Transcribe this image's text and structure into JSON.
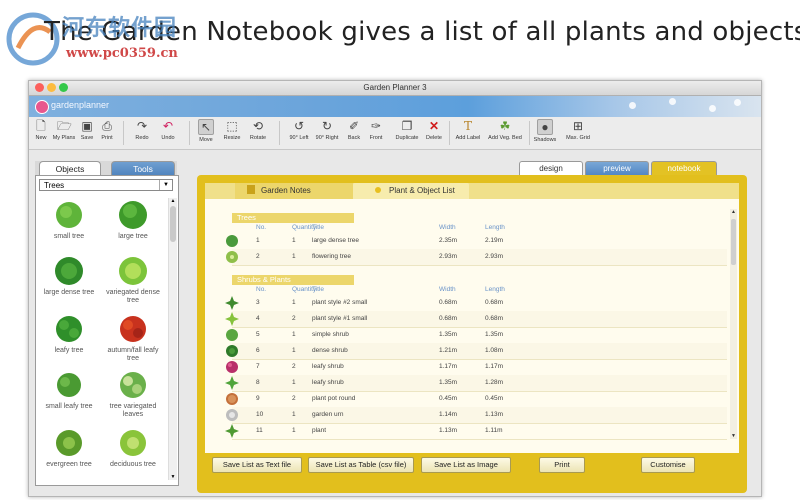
{
  "caption": "The Garden Notebook gives a list of all plants and objects",
  "watermark": {
    "cn": "河东软件园",
    "url": "www.pc0359.cn"
  },
  "window": {
    "title": "Garden Planner 3"
  },
  "banner": {
    "app_name": "gardenplanner"
  },
  "toolbar": {
    "new": "New",
    "my_plans": "My Plans",
    "save": "Save",
    "print": "Print",
    "redo": "Redo",
    "undo": "Undo",
    "move": "Move",
    "resize": "Resize",
    "rotate": "Rotate",
    "rot_left": "90° Left",
    "rot_right": "90° Right",
    "back": "Back",
    "front": "Front",
    "duplicate": "Duplicate",
    "delete": "Delete",
    "add_label": "Add Label",
    "add_veg_bed": "Add Veg. Bed",
    "shadows": "Shadows",
    "max_grid": "Max. Grid"
  },
  "left_panel": {
    "tab_objects": "Objects",
    "tab_tools": "Tools",
    "category": "Trees",
    "items": [
      {
        "label": "small tree",
        "icon": "small-tree-icon"
      },
      {
        "label": "large tree",
        "icon": "large-tree-icon"
      },
      {
        "label": "large dense tree",
        "icon": "large-dense-tree-icon"
      },
      {
        "label": "variegated dense tree",
        "icon": "variegated-dense-tree-icon"
      },
      {
        "label": "leafy tree",
        "icon": "leafy-tree-icon"
      },
      {
        "label": "autumn/fall leafy tree",
        "icon": "autumn-leafy-tree-icon"
      },
      {
        "label": "small leafy tree",
        "icon": "small-leafy-tree-icon"
      },
      {
        "label": "tree variegated leaves",
        "icon": "tree-variegated-leaves-icon"
      },
      {
        "label": "evergreen tree",
        "icon": "evergreen-tree-icon"
      },
      {
        "label": "deciduous tree",
        "icon": "deciduous-tree-icon"
      }
    ]
  },
  "view_tabs": {
    "design": "design",
    "preview": "preview",
    "notebook": "notebook"
  },
  "notebook": {
    "tab_garden_notes": "Garden Notes",
    "tab_plant_list": "Plant & Object List",
    "columns": {
      "no": "No.",
      "quantity": "Quantity",
      "title": "Title",
      "width": "Width",
      "length": "Length"
    },
    "sections": [
      {
        "name": "Trees",
        "rows": [
          {
            "no": "1",
            "qty": "1",
            "title": "large dense tree",
            "width": "2.35m",
            "length": "2.19m",
            "color": "#4a9a3c"
          },
          {
            "no": "2",
            "qty": "1",
            "title": "flowering tree",
            "width": "2.93m",
            "length": "2.93m",
            "color": "#8fbf4a"
          }
        ]
      },
      {
        "name": "Shrubs & Plants",
        "rows": [
          {
            "no": "3",
            "qty": "1",
            "title": "plant style #2  small",
            "width": "0.68m",
            "length": "0.68m",
            "color": "#3f8a2e"
          },
          {
            "no": "4",
            "qty": "2",
            "title": "plant style #1  small",
            "width": "0.68m",
            "length": "0.68m",
            "color": "#86c23c"
          },
          {
            "no": "5",
            "qty": "1",
            "title": "simple shrub",
            "width": "1.35m",
            "length": "1.35m",
            "color": "#5aa640"
          },
          {
            "no": "6",
            "qty": "1",
            "title": "dense shrub",
            "width": "1.21m",
            "length": "1.08m",
            "color": "#2f7a2a"
          },
          {
            "no": "7",
            "qty": "2",
            "title": "leafy shrub",
            "width": "1.17m",
            "length": "1.17m",
            "color": "#b8306a"
          },
          {
            "no": "8",
            "qty": "1",
            "title": "leafy shrub",
            "width": "1.35m",
            "length": "1.28m",
            "color": "#4fa43a"
          },
          {
            "no": "9",
            "qty": "2",
            "title": "plant pot  round",
            "width": "0.45m",
            "length": "0.45m",
            "color": "#c4703a"
          },
          {
            "no": "10",
            "qty": "1",
            "title": "garden urn",
            "width": "1.14m",
            "length": "1.13m",
            "color": "#bdbdbd"
          },
          {
            "no": "11",
            "qty": "1",
            "title": "plant",
            "width": "1.13m",
            "length": "1.11m",
            "color": "#4f9a32"
          }
        ]
      }
    ],
    "buttons": {
      "save_text": "Save List as Text file",
      "save_csv": "Save List as Table (csv file)",
      "save_image": "Save List as Image",
      "print": "Print",
      "customise": "Customise"
    }
  }
}
